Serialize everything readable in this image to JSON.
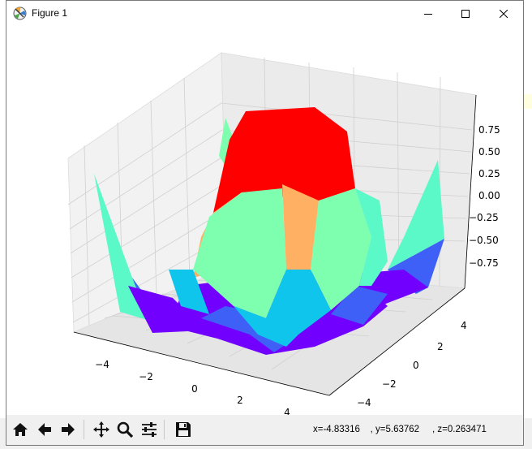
{
  "window": {
    "title": "Figure 1",
    "icon": "matplotlib-icon",
    "controls": [
      "minimize-icon",
      "maximize-icon",
      "close-icon"
    ]
  },
  "plot": {
    "type": "surface-3d",
    "colormap": "rainbow",
    "x_ticks": [
      "−4",
      "−2",
      "0",
      "2",
      "4"
    ],
    "y_ticks": [
      "4",
      "2",
      "0",
      "−2",
      "−4"
    ],
    "z_ticks": [
      "0.75",
      "0.50",
      "0.25",
      "0.00",
      "−0.25",
      "−0.50",
      "−0.75"
    ],
    "colors": {
      "red": "#ff0000",
      "orange": "#ffb062",
      "aqua": "#7effb0",
      "cyan": "#0fc5eb",
      "blue": "#3f60f7",
      "violet": "#7100ff",
      "mint": "#5bf8c8"
    }
  },
  "toolbar": {
    "buttons": [
      "home-icon",
      "back-icon",
      "forward-icon",
      "pan-icon",
      "zoom-icon",
      "configure-icon",
      "save-icon"
    ],
    "coords_text": "x=-4.83316    , y=5.63762     , z=0.263471"
  }
}
